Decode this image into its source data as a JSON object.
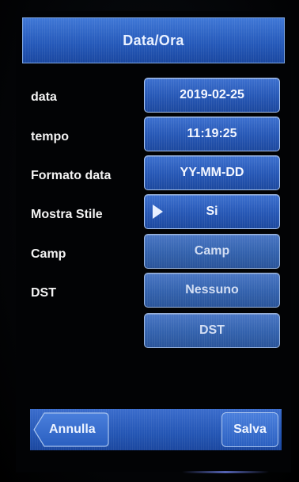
{
  "header": {
    "title": "Data/Ora"
  },
  "rows": [
    {
      "label": "data",
      "value": "2019-02-25"
    },
    {
      "label": "tempo",
      "value": "11:19:25"
    },
    {
      "label": "Formato data",
      "value": "YY-MM-DD"
    },
    {
      "label": "Mostra Stile",
      "value": "Si"
    },
    {
      "label": "Camp",
      "value": "Camp"
    },
    {
      "label": "DST",
      "value": "Nessuno"
    }
  ],
  "dst_button": {
    "label": "DST"
  },
  "footer": {
    "cancel_label": "Annulla",
    "save_label": "Salva"
  },
  "colors": {
    "accent": "#2a5fc0",
    "border": "#a8c4f0",
    "background": "#020305"
  },
  "icons": {
    "selected_marker": "play-arrow-icon",
    "back_shape": "chevron-left-button"
  }
}
